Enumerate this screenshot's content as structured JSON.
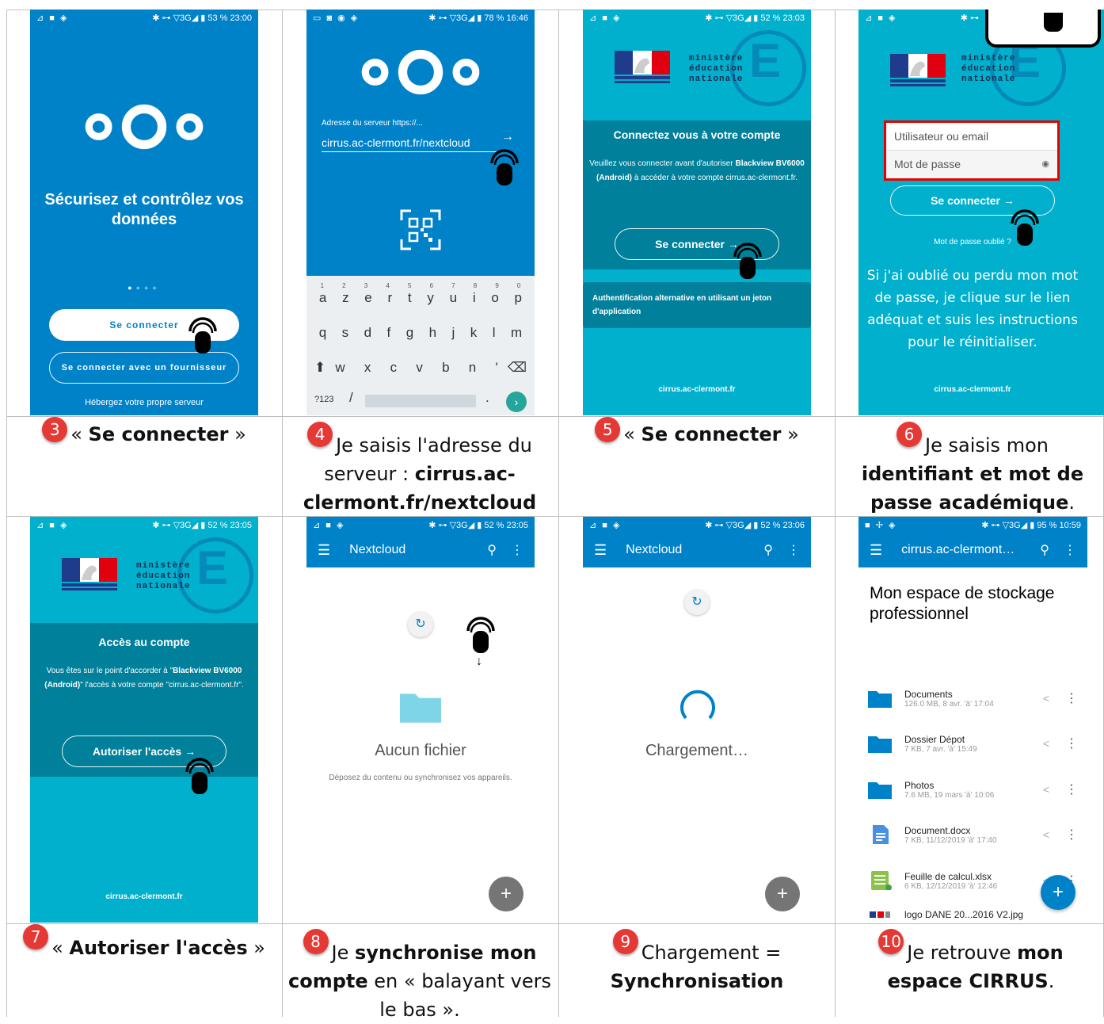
{
  "status_bars": [
    {
      "left": "⊿ ■ ◈",
      "right": "✱ ⊶ ▽3G◢ ▮ 53 % 23:00"
    },
    {
      "left": "▭ ◙ ◉ ◈",
      "right": "✱ ⊶ ▽3G◢ ▮ 78 % 16:46"
    },
    {
      "left": "⊿ ■ ◈",
      "right": "✱ ⊶ ▽3G◢ ▮ 52 % 23:03"
    },
    {
      "left": "⊿ ■ ◈",
      "right": "✱ ⊶"
    },
    {
      "left": "⊿ ■ ◈",
      "right": "✱ ⊶ ▽3G◢ ▮ 52 % 23:05"
    },
    {
      "left": "⊿ ■ ◈",
      "right": "✱ ⊶ ▽3G◢ ▮ 52 % 23:05"
    },
    {
      "left": "⊿ ■ ◈",
      "right": "✱ ⊶ ▽3G◢ ▮ 52 % 23:06"
    },
    {
      "left": "■ ✢ ◈",
      "right": "✱ ⊶ ▽3G◢ ▮ 95 % 10:59"
    }
  ],
  "s1": {
    "headline": "Sécurisez et contrôlez vos données",
    "btn_connect": "Se connecter",
    "btn_provider": "Se connecter avec un fournisseur",
    "footer": "Hébergez votre propre serveur"
  },
  "s2": {
    "server_label": "Adresse du serveur https://...",
    "server_value": "cirrus.ac-clermont.fr/nextcloud",
    "kb_row1": [
      "a",
      "z",
      "e",
      "r",
      "t",
      "y",
      "u",
      "i",
      "o",
      "p"
    ],
    "kb_nums": [
      "1",
      "2",
      "3",
      "4",
      "5",
      "6",
      "7",
      "8",
      "9",
      "0"
    ],
    "kb_row2": [
      "q",
      "s",
      "d",
      "f",
      "g",
      "h",
      "j",
      "k",
      "l",
      "m"
    ],
    "kb_row3": [
      "w",
      "x",
      "c",
      "v",
      "b",
      "n",
      "'"
    ],
    "kb_sym": "?123",
    "kb_slash": "/",
    "kb_dot": "."
  },
  "ministere": {
    "l1": "ministère",
    "l2": "éducation",
    "l3": "nationale",
    "mark": "E"
  },
  "s3": {
    "title": "Connectez vous à votre compte",
    "text1": "Veuillez vous connecter avant d'autoriser ",
    "device": "Blackview BV6000 (Android)",
    "text2": " à accéder à votre compte cirrus.ac-clermont.fr.",
    "btn": "Se connecter",
    "alt": "Authentification alternative en utilisant un jeton d'application",
    "footer": "cirrus.ac-clermont.fr"
  },
  "s4": {
    "user_placeholder": "Utilisateur ou email",
    "pass_placeholder": "Mot de passe",
    "btn": "Se connecter",
    "forgot": "Mot de passe oublié ?",
    "note": "Si j'ai oublié ou perdu mon mot de passe, je clique sur le lien adéquat et suis les instructions pour le réinitialiser.",
    "footer": "cirrus.ac-clermont.fr"
  },
  "s5": {
    "title": "Accès au compte",
    "text1": "Vous êtes sur le point d'accorder à \"",
    "device": "Blackview BV6000 (Android)",
    "text2": "\" l'accès à votre compte \"cirrus.ac-clermont.fr\".",
    "btn": "Autoriser l'accès",
    "footer": "cirrus.ac-clermont.fr"
  },
  "s6": {
    "title": "Nextcloud",
    "empty": "Aucun fichier",
    "hint": "Déposez du contenu ou synchronisez vos appareils."
  },
  "s7": {
    "title": "Nextcloud",
    "loading": "Chargement…"
  },
  "s8": {
    "title": "cirrus.ac-clermont…",
    "heading": "Mon espace de stockage professionnel",
    "files": [
      {
        "name": "Documents",
        "meta": "126.0 MB, 8 avr. 'à' 17:04"
      },
      {
        "name": "Dossier Dépot",
        "meta": "7 KB, 7 avr. 'à' 15:49"
      },
      {
        "name": "Photos",
        "meta": "7.6 MB, 19 mars 'à' 10:06"
      },
      {
        "name": "Document.docx",
        "meta": "7 KB, 11/12/2019 'à' 17:40"
      },
      {
        "name": "Feuille de calcul.xlsx",
        "meta": "6 KB, 12/12/2019 'à' 12:46"
      },
      {
        "name": "logo DANE 20...2016 V2.jpg",
        "meta": ""
      }
    ]
  },
  "captions": {
    "c3": {
      "n": "3",
      "pre": "« ",
      "bold": "Se connecter",
      "post": " »"
    },
    "c4": {
      "n": "4",
      "pre": "Je saisis l'adresse du serveur : ",
      "bold": "cirrus.ac-clermont.fr/nextcloud",
      "post": ""
    },
    "c5": {
      "n": "5",
      "pre": "« ",
      "bold": "Se connecter",
      "post": " »"
    },
    "c6": {
      "n": "6",
      "pre": "Je saisis mon ",
      "bold": "identifiant et mot de passe académique",
      "post": "."
    },
    "c7": {
      "n": "7",
      "pre": "« ",
      "bold": "Autoriser l'accès",
      "post": " »"
    },
    "c8": {
      "n": "8",
      "pre": "Je ",
      "bold": "synchronise mon compte",
      "post": " en « balayant vers le bas »."
    },
    "c9": {
      "n": "9",
      "pre": "Chargement = ",
      "bold": "Synchronisation",
      "post": ""
    },
    "c10": {
      "n": "10",
      "pre": "Je retrouve ",
      "bold": "mon espace CIRRUS",
      "post": "."
    }
  },
  "colors": {
    "nextcloud_blue": "#0082c9",
    "ac_cyan": "#00b0cc",
    "ac_dark": "#00809a",
    "badge_red": "#e53935"
  }
}
